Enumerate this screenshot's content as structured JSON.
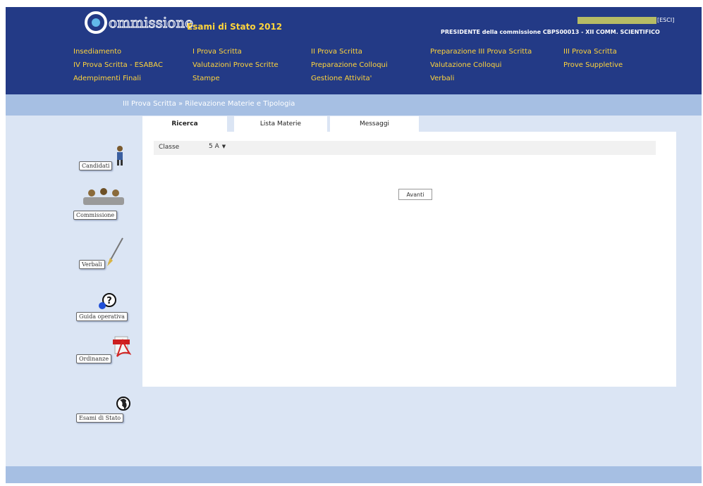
{
  "header": {
    "logo_text": "ommissione",
    "app_title": "Esami di Stato 2012",
    "exit_link": "[ESCI]",
    "role_text": "PRESIDENTE della commissione CBPS00013 - XII COMM. SCIENTIFICO"
  },
  "menu": {
    "items": [
      "Insediamento",
      "I Prova Scritta",
      "II Prova Scritta",
      "Preparazione III Prova Scritta",
      "III Prova Scritta",
      "IV Prova Scritta - ESABAC",
      "Valutazioni Prove Scritte",
      "Preparazione Colloqui",
      "Valutazione Colloqui",
      "Prove Suppletive",
      "Adempimenti Finali",
      "Stampe",
      "Gestione Attivita'",
      "Verbali"
    ]
  },
  "breadcrumb": "III Prova Scritta » Rilevazione Materie e Tipologia",
  "tabs": [
    "Ricerca",
    "Lista Materie",
    "Messaggi"
  ],
  "form": {
    "classe_label": "Classe",
    "classe_value": "5 A",
    "avanti_label": "Avanti"
  },
  "side": {
    "candidati": "Candidati",
    "commissione": "Commissione",
    "verbali": "Verbali",
    "guida": "Guida operativa",
    "ordinanze": "Ordinanze",
    "esami": "Esami di Stato"
  },
  "colors": {
    "header_bg": "#233a86",
    "menu_text": "#ffd43b",
    "breadcrumb_bg": "#a6bfe3",
    "page_bg": "#dbe5f4"
  }
}
